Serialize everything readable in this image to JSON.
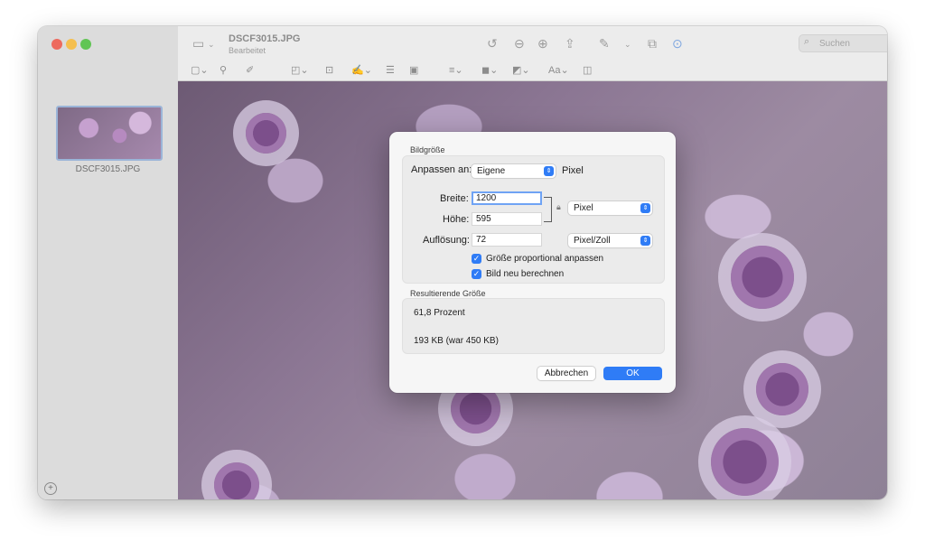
{
  "window": {
    "title": "DSCF3015.JPG",
    "subtitle": "Bearbeitet"
  },
  "sidebar": {
    "thumbnail_label": "DSCF3015.JPG"
  },
  "toolbar": {
    "search_placeholder": "Suchen"
  },
  "dialog": {
    "section_size": "Bildgröße",
    "fit_label": "Anpassen an:",
    "fit_value": "Eigene",
    "fit_unit": "Pixel",
    "width_label": "Breite:",
    "width_value": "1200",
    "height_label": "Höhe:",
    "height_value": "595",
    "size_unit": "Pixel",
    "resolution_label": "Auflösung:",
    "resolution_value": "72",
    "resolution_unit": "Pixel/Zoll",
    "proportional_label": "Größe proportional anpassen",
    "proportional_checked": true,
    "resample_label": "Bild neu berechnen",
    "resample_checked": true,
    "section_result": "Resultierende Größe",
    "result_percent": "61,8 Prozent",
    "result_filesize": "193 KB (war 450 KB)",
    "cancel_label": "Abbrechen",
    "ok_label": "OK"
  },
  "colors": {
    "accent": "#2f7cf6",
    "traffic_close": "#ed6a5e",
    "traffic_minimize": "#f5bf4f",
    "traffic_zoom": "#61c554"
  }
}
